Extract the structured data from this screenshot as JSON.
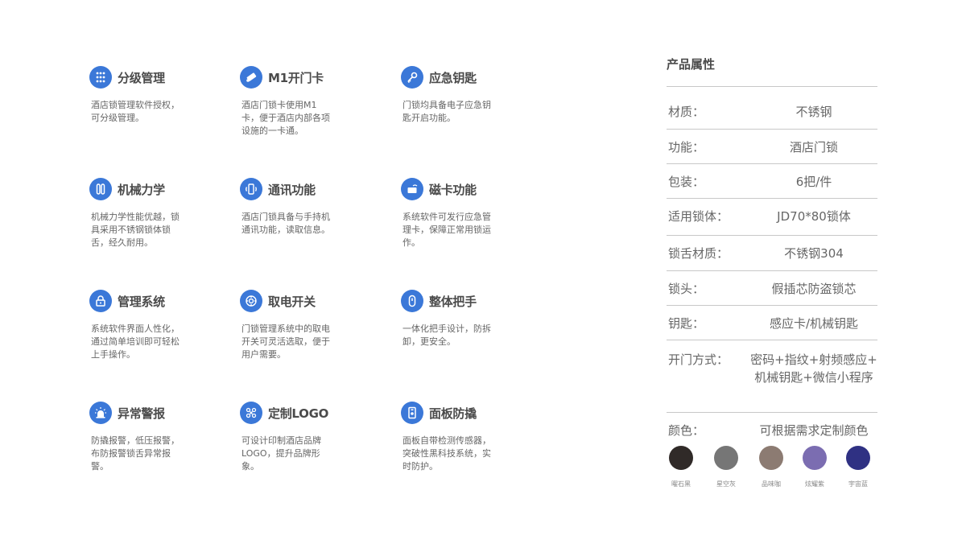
{
  "features": [
    {
      "title": "分级管理",
      "icon": "keypad-icon",
      "desc": "酒店锁管理软件授权，可分级管理。"
    },
    {
      "title": "M1开门卡",
      "icon": "card-key-icon",
      "desc": "酒店门锁卡使用M1卡，便于酒店内部各项设施的一卡通。"
    },
    {
      "title": "应急钥匙",
      "icon": "key-icon",
      "desc": "门锁均具备电子应急钥匙开启功能。"
    },
    {
      "title": "机械力学",
      "icon": "mechanical-icon",
      "desc": "机械力学性能优越，锁具采用不锈钢锁体锁舌，经久耐用。"
    },
    {
      "title": "通讯功能",
      "icon": "phone-signal-icon",
      "desc": "酒店门锁具备与手持机通讯功能，读取信息。"
    },
    {
      "title": "磁卡功能",
      "icon": "magnetic-card-icon",
      "desc": "系统软件可发行应急管理卡，保障正常用锁运作。"
    },
    {
      "title": "管理系统",
      "icon": "lock-icon",
      "desc": "系统软件界面人性化，通过简单培训即可轻松上手操作。"
    },
    {
      "title": "取电开关",
      "icon": "power-switch-icon",
      "desc": "门锁管理系统中的取电开关可灵活选取，便于用户需要。"
    },
    {
      "title": "整体把手",
      "icon": "handle-icon",
      "desc": "一体化把手设计，防拆卸，更安全。"
    },
    {
      "title": "异常警报",
      "icon": "alarm-icon",
      "desc": "防撬报警，低压报警，布防报警锁舌异常报警。"
    },
    {
      "title": "定制LOGO",
      "icon": "logo-custom-icon",
      "desc": "可设计印制酒店品牌LOGO，提升品牌形象。"
    },
    {
      "title": "面板防撬",
      "icon": "panel-icon",
      "desc": "面板自带检测传感器，突破性黑科技系统，实时防护。"
    }
  ],
  "attributes": {
    "title": "产品属性",
    "rows": [
      {
        "key": "材质：",
        "value": "不锈钢"
      },
      {
        "key": "功能：",
        "value": "酒店门锁"
      },
      {
        "key": "包装：",
        "value": "6把/件"
      },
      {
        "key": "适用锁体：",
        "value": "JD70*80锁体"
      },
      {
        "key": "锁舌材质：",
        "value": "不锈钢304"
      },
      {
        "key": "锁头：",
        "value": "假插芯防盗锁芯"
      },
      {
        "key": "钥匙：",
        "value": "感应卡/机械钥匙"
      },
      {
        "key": "开门方式：",
        "value": "密码+指纹+射频感应+\n机械钥匙+微信小程序"
      },
      {
        "key": "颜色：",
        "value": "可根据需求定制颜色"
      }
    ],
    "colors": [
      {
        "name": "曜石黑",
        "hex": "#302a28"
      },
      {
        "name": "星空灰",
        "hex": "#767676"
      },
      {
        "name": "品味咖",
        "hex": "#8c7b72"
      },
      {
        "name": "炫耀紫",
        "hex": "#7b6db1"
      },
      {
        "name": "宇宙蓝",
        "hex": "#2f3183"
      }
    ]
  },
  "accent": "#3b78d8"
}
